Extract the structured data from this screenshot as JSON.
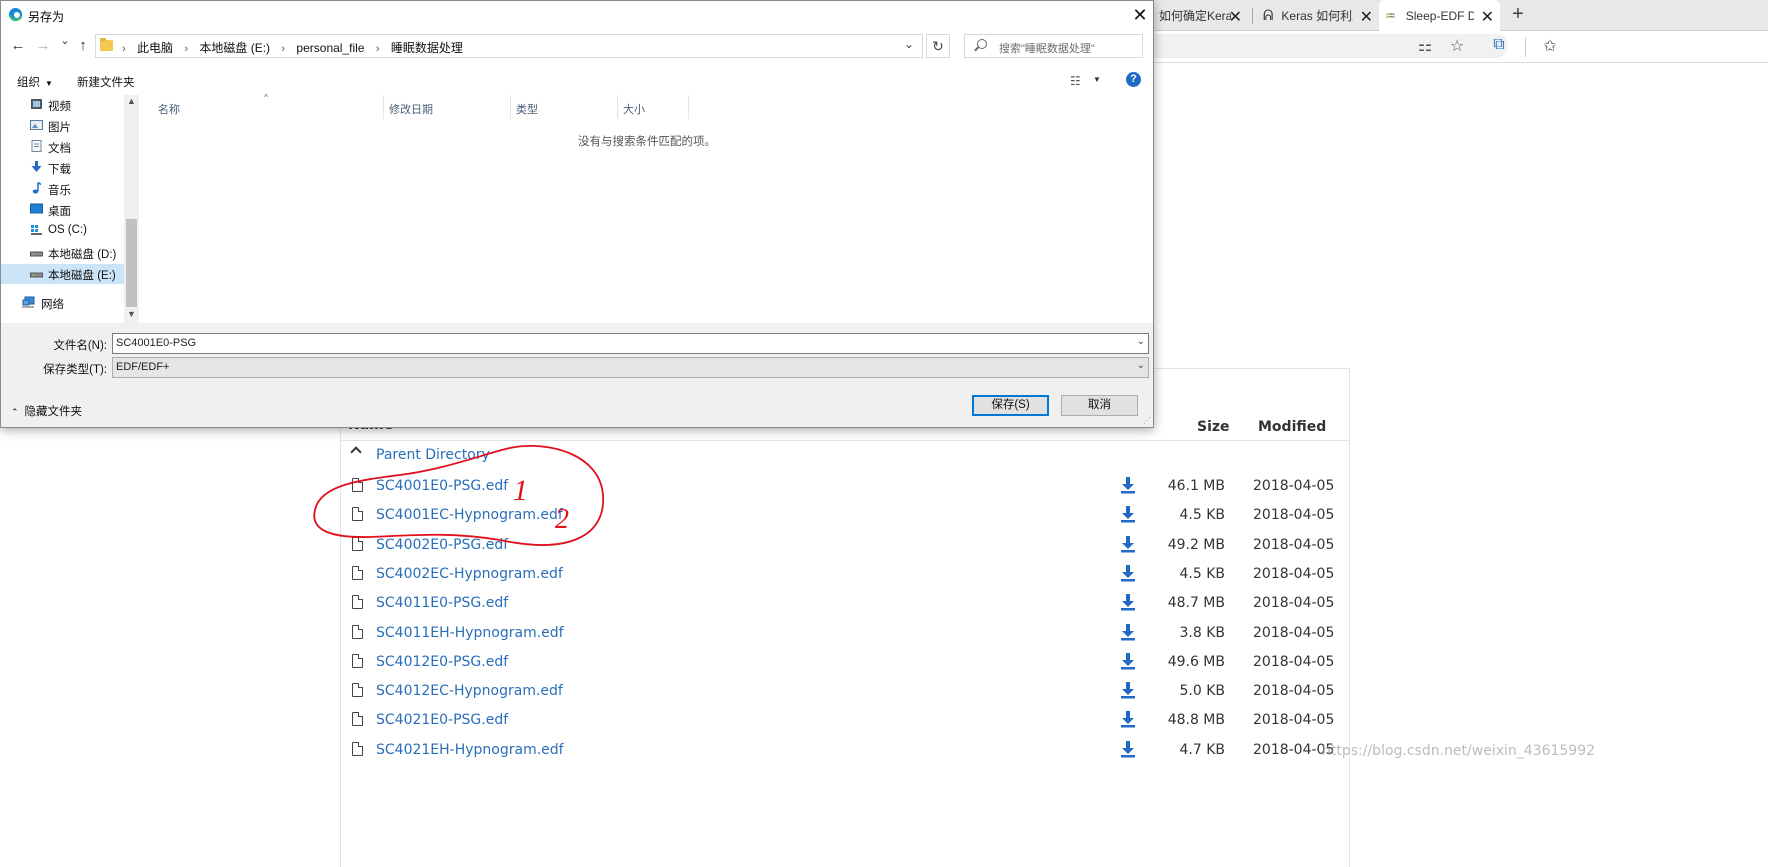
{
  "dialog": {
    "title": "另存为",
    "close_glyph": "✕",
    "nav": {
      "back": "←",
      "forward": "→",
      "recent": "⌄",
      "up": "↑"
    },
    "breadcrumbs": [
      "此电脑",
      "本地磁盘 (E:)",
      "personal_file",
      "睡眠数据处理"
    ],
    "crumb_separator": "›",
    "refresh_glyph": "↻",
    "search_placeholder": "搜索\"睡眠数据处理\"",
    "commands": {
      "organize": "组织",
      "new_folder": "新建文件夹"
    },
    "help_glyph": "?",
    "nav_pane": [
      {
        "label": "视频",
        "icon": "video-icon"
      },
      {
        "label": "图片",
        "icon": "pictures-icon"
      },
      {
        "label": "文档",
        "icon": "documents-icon"
      },
      {
        "label": "下载",
        "icon": "download-icon"
      },
      {
        "label": "音乐",
        "icon": "music-icon"
      },
      {
        "label": "桌面",
        "icon": "desktop-icon"
      },
      {
        "label": "OS (C:)",
        "icon": "os-drive-icon"
      },
      {
        "label": "本地磁盘 (D:)",
        "icon": "drive-icon"
      },
      {
        "label": "本地磁盘 (E:)",
        "icon": "drive-icon",
        "selected": true
      },
      {
        "label": "网络",
        "icon": "network-icon"
      }
    ],
    "columns": [
      "名称",
      "修改日期",
      "类型",
      "大小"
    ],
    "empty_message": "没有与搜索条件匹配的项。",
    "filename_label": "文件名(N):",
    "filename_value": "SC4001E0-PSG",
    "filetype_label": "保存类型(T):",
    "filetype_value": "EDF/EDF+",
    "hide_folders_label": "隐藏文件夹",
    "save_button": "保存(S)",
    "cancel_button": "取消"
  },
  "browser": {
    "tabs": [
      {
        "title": "如何确定Kera",
        "active": false
      },
      {
        "title": "Keras 如何利用",
        "active": false
      },
      {
        "title": "Sleep-EDF Dat",
        "active": true
      }
    ],
    "new_tab_glyph": "+",
    "tab_close_glyph": "✕"
  },
  "listing": {
    "headers": {
      "name": "Name",
      "size": "Size",
      "modified": "Modified"
    },
    "parent": "Parent Directory",
    "files": [
      {
        "name": "SC4001E0-PSG.edf",
        "size": "46.1 MB",
        "modified": "2018-04-05"
      },
      {
        "name": "SC4001EC-Hypnogram.edf",
        "size": "4.5 KB",
        "modified": "2018-04-05"
      },
      {
        "name": "SC4002E0-PSG.edf",
        "size": "49.2 MB",
        "modified": "2018-04-05"
      },
      {
        "name": "SC4002EC-Hypnogram.edf",
        "size": "4.5 KB",
        "modified": "2018-04-05"
      },
      {
        "name": "SC4011E0-PSG.edf",
        "size": "48.7 MB",
        "modified": "2018-04-05"
      },
      {
        "name": "SC4011EH-Hypnogram.edf",
        "size": "3.8 KB",
        "modified": "2018-04-05"
      },
      {
        "name": "SC4012E0-PSG.edf",
        "size": "49.6 MB",
        "modified": "2018-04-05"
      },
      {
        "name": "SC4012EC-Hypnogram.edf",
        "size": "5.0 KB",
        "modified": "2018-04-05"
      },
      {
        "name": "SC4021E0-PSG.edf",
        "size": "48.8 MB",
        "modified": "2018-04-05"
      },
      {
        "name": "SC4021EH-Hypnogram.edf",
        "size": "4.7 KB",
        "modified": "2018-04-05"
      }
    ],
    "annotations": [
      "1",
      "2"
    ],
    "watermark": "https://blog.csdn.net/weixin_43615992"
  },
  "colors": {
    "link": "#2a6ebb",
    "download": "#1f6bc6",
    "annotation": "#e0101e",
    "selection": "#cce4f7",
    "accent": "#0078d7"
  }
}
